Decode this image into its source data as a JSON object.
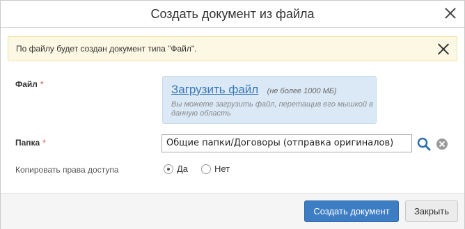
{
  "dialog": {
    "title": "Создать документ из файла"
  },
  "notice": {
    "text": "По файлу будет создан документ типа \"Файл\"."
  },
  "file_field": {
    "label": "Файл",
    "required_mark": "*",
    "upload_link": "Загрузить файл",
    "limit": "(не более 1000 МБ)",
    "hint": "Вы можете загрузить файл, перетащив его мышкой в данную область"
  },
  "folder_field": {
    "label": "Папка",
    "required_mark": "*",
    "value": "Общие папки/Договоры (отправка оригиналов)"
  },
  "access": {
    "label": "Копировать права доступа",
    "options": [
      {
        "label": "Да",
        "checked": true
      },
      {
        "label": "Нет",
        "checked": false
      }
    ]
  },
  "footer": {
    "create_label": "Создать документ",
    "close_label": "Закрыть"
  },
  "colors": {
    "primary": "#3d7dc4",
    "notice_bg": "#fcf8e3",
    "upload_bg": "#dbe9f7",
    "required": "#d9534f"
  },
  "icons": {
    "dialog_close": "close-icon",
    "notice_close": "close-icon",
    "folder_search": "search-icon",
    "folder_clear": "clear-icon"
  }
}
